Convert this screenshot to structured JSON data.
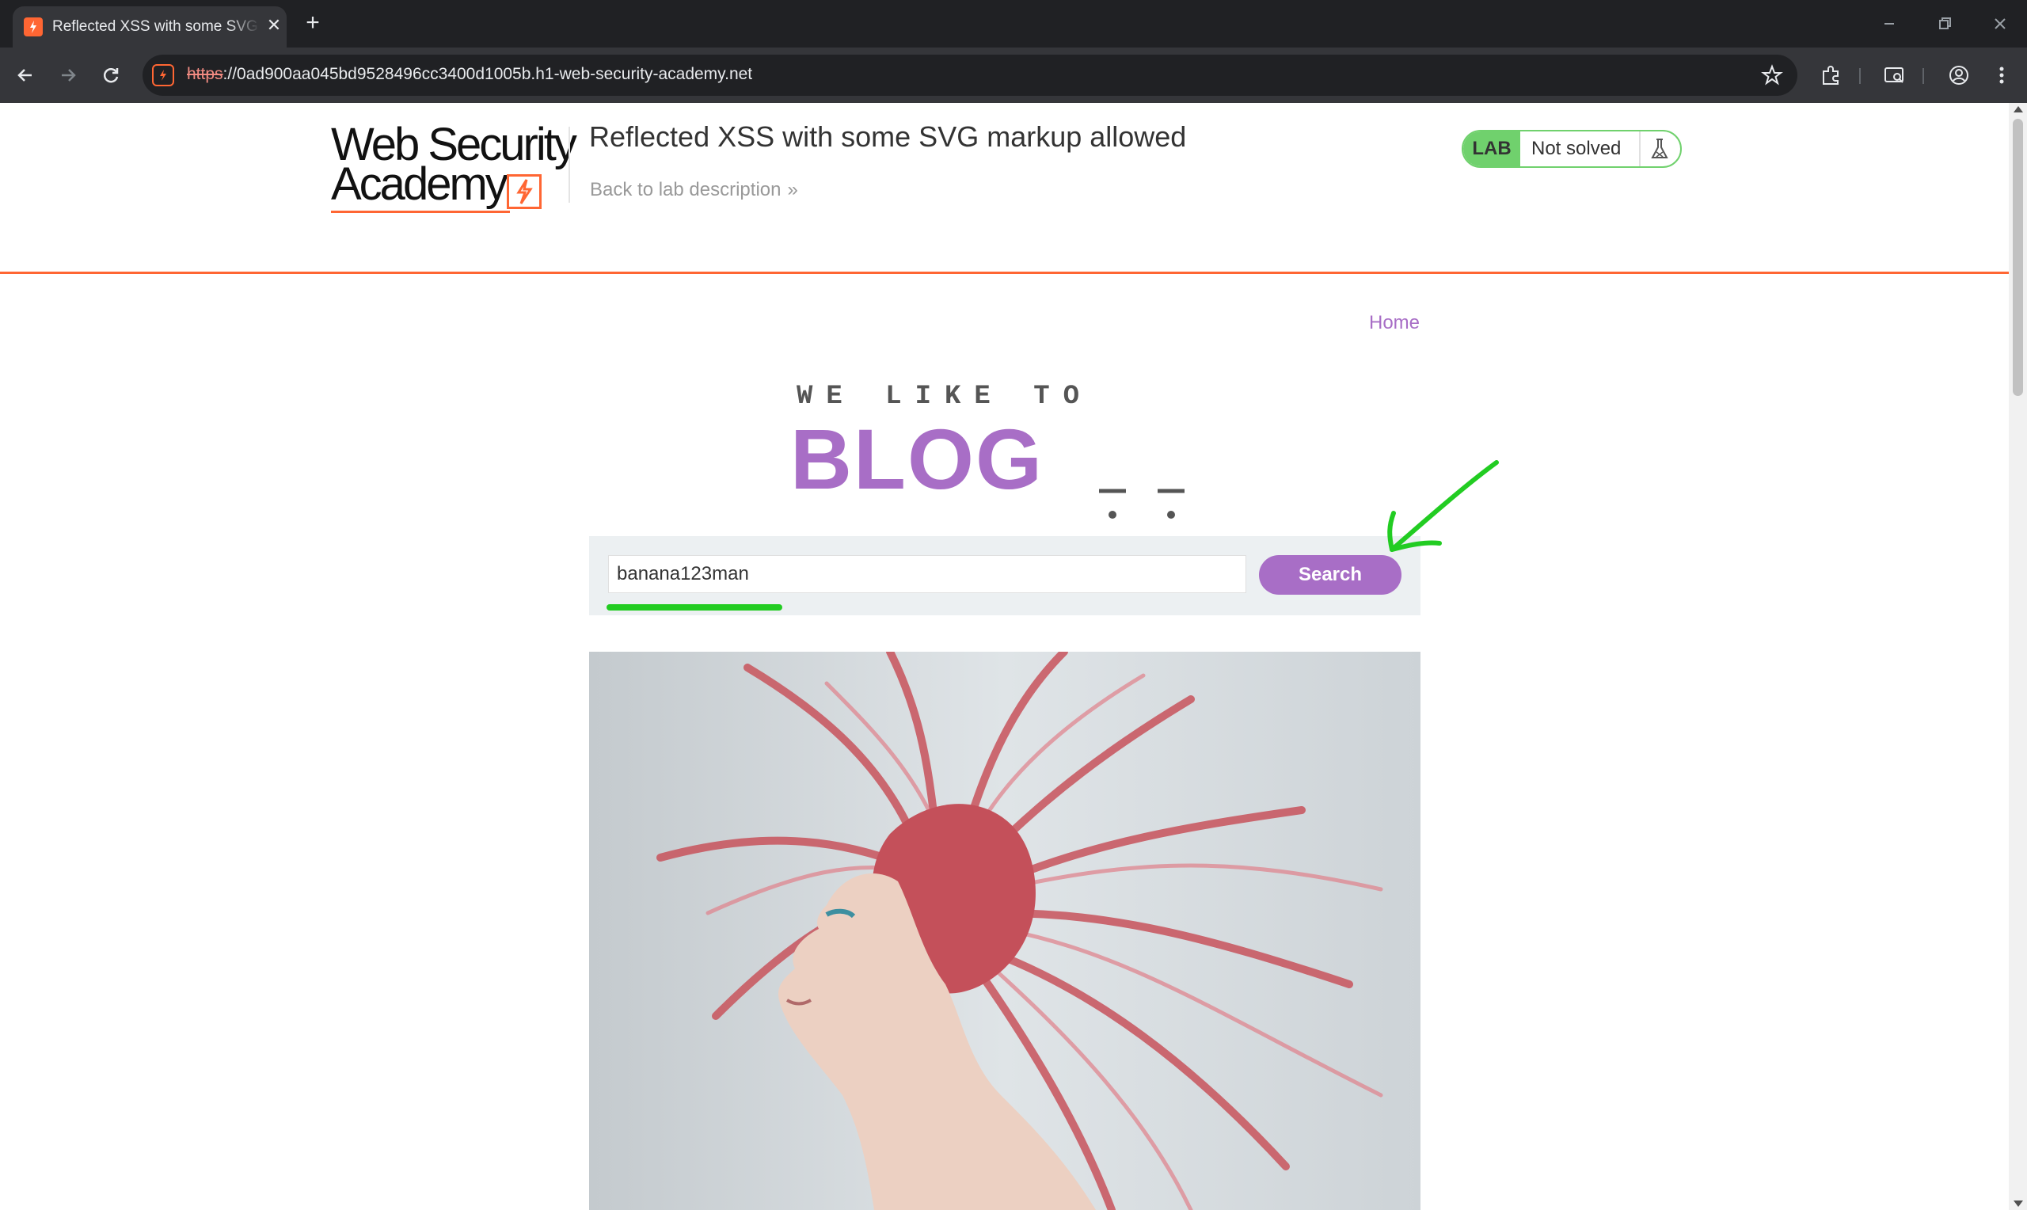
{
  "browser": {
    "tab_title": "Reflected XSS with some SVG markup allowed",
    "url_scheme": "https",
    "url_rest": "://0ad900aa045bd9528496cc3400d1005b.h1-web-security-academy.net"
  },
  "academy_header": {
    "logo_line1": "Web Security",
    "logo_line2": "Academy",
    "lab_title": "Reflected XSS with some SVG markup allowed",
    "back_link": "Back to lab description",
    "lab_badge": "LAB",
    "lab_status": "Not solved"
  },
  "nav": {
    "home": "Home"
  },
  "banner": {
    "tagline": "WE LIKE TO",
    "title": "BLOG"
  },
  "search": {
    "value": "banana123man",
    "button": "Search"
  },
  "colors": {
    "accent": "#a86ec6",
    "brand_orange": "#ff6633",
    "lab_green": "#70d16d",
    "annotation_green": "#22cc22"
  }
}
